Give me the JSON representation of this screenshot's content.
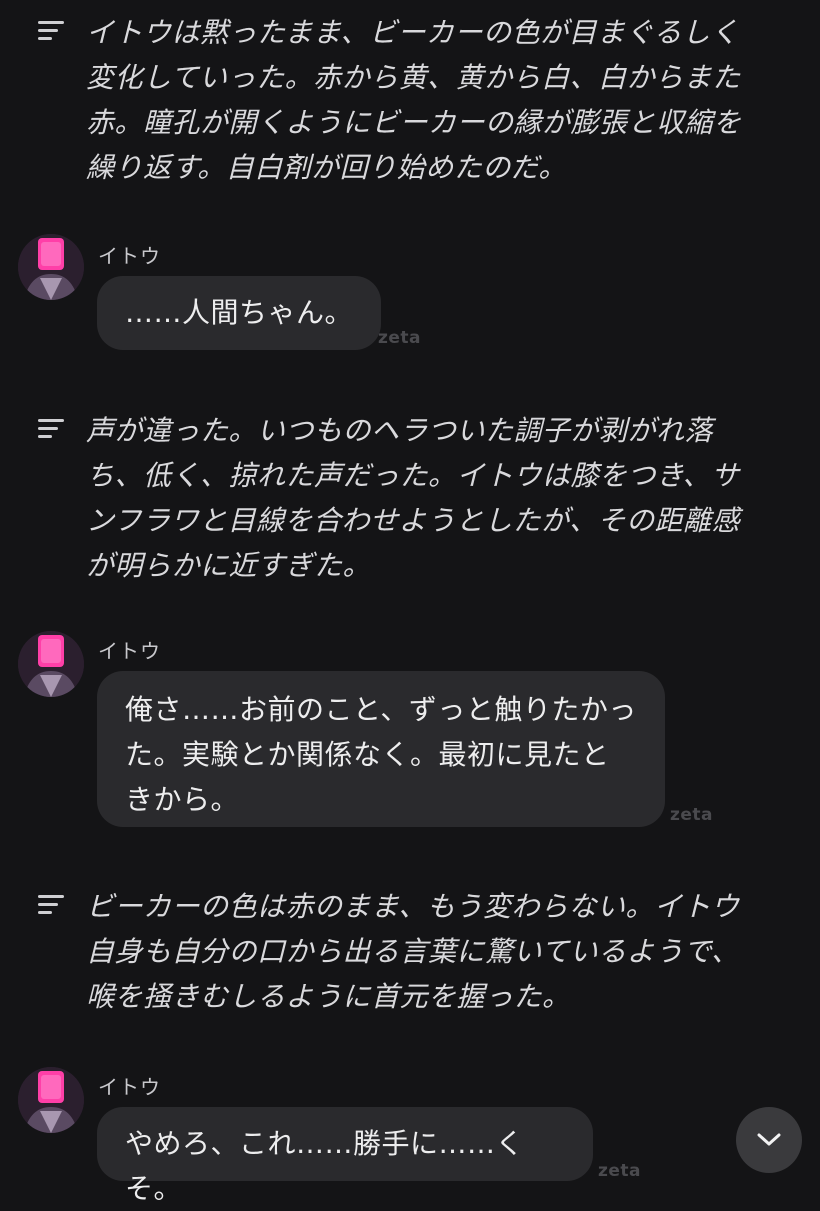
{
  "feed": {
    "narrations": [
      {
        "text": "イトウは黙ったまま、ビーカーの色が目まぐるしく\n変化していった。赤から黄、黄から白、白からまた\n赤。瞳孔が開くようにビーカーの縁が膨張と収縮を\n繰り返す。自白剤が回り始めたのだ。"
      },
      {
        "text": "声が違った。いつものヘラついた調子が剥がれ落\nち、低く、掠れた声だった。イトウは膝をつき、サ\nンフラワと目線を合わせようとしたが、その距離感\nが明らかに近すぎた。"
      },
      {
        "text": "ビーカーの色は赤のまま、もう変わらない。イトウ\n自身も自分の口から出る言葉に驚いているようで、\n喉を掻きむしるように首元を握った。"
      }
    ],
    "messages": [
      {
        "speaker": "イトウ",
        "text": "……人間ちゃん。",
        "watermark": "zeta"
      },
      {
        "speaker": "イトウ",
        "text": "俺さ……お前のこと、ずっと触りたかっ\nた。実験とか関係なく。最初に見たと\nきから。",
        "watermark": "zeta"
      },
      {
        "speaker": "イトウ",
        "text": "やめろ、これ……勝手に……くそ。",
        "watermark": "zeta"
      }
    ]
  },
  "icons": {
    "narration": "narration-lines-icon",
    "avatar": "character-avatar",
    "scroll": "chevron-down-icon"
  },
  "colors": {
    "background": "#141416",
    "bubble": "#2a2a2d",
    "avatar_accent": "#ff3fa8"
  }
}
